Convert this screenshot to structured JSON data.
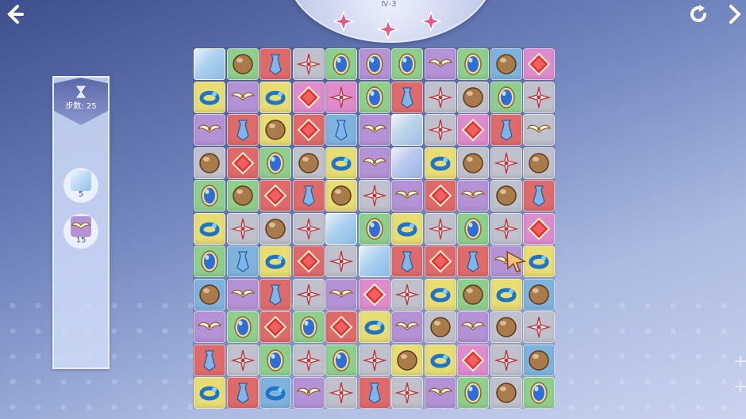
{
  "level": "Ⅳ-3",
  "stars": 3,
  "moves_label": "步数: 25",
  "goals": [
    {
      "icon": "ice-block-icon",
      "count": "5"
    },
    {
      "icon": "wing-bow-gem-icon",
      "count": "15"
    }
  ],
  "colors": {
    "yellow": "#e7dd73",
    "purple": "#b492d6",
    "red": "#df6a6a",
    "gray": "#bfc2cc",
    "green": "#8fcf8d",
    "blue": "#7fb3dd",
    "pink": "#de8ccc"
  },
  "board": [
    [
      [
        "blue",
        "ice"
      ],
      [
        "green",
        "ball"
      ],
      [
        "red",
        "tie"
      ],
      [
        "gray",
        "flower"
      ],
      [
        "green",
        "oval"
      ],
      [
        "purple",
        "oval"
      ],
      [
        "green",
        "oval"
      ],
      [
        "purple",
        "bow"
      ],
      [
        "green",
        "oval"
      ],
      [
        "blue",
        "ball"
      ],
      [
        "pink",
        "diamond"
      ]
    ],
    [
      [
        "yellow",
        "ring"
      ],
      [
        "purple",
        "bow"
      ],
      [
        "yellow",
        "ring"
      ],
      [
        "pink",
        "diamond"
      ],
      [
        "pink",
        "flower"
      ],
      [
        "green",
        "oval"
      ],
      [
        "red",
        "tie"
      ],
      [
        "gray",
        "flower"
      ],
      [
        "gray",
        "ball"
      ],
      [
        "green",
        "oval"
      ],
      [
        "gray",
        "flower"
      ]
    ],
    [
      [
        "purple",
        "bow"
      ],
      [
        "red",
        "tie"
      ],
      [
        "yellow",
        "ball"
      ],
      [
        "red",
        "diamond"
      ],
      [
        "blue",
        "tie"
      ],
      [
        "purple",
        "bow"
      ],
      [
        "gray",
        "ice"
      ],
      [
        "gray",
        "flower"
      ],
      [
        "pink",
        "diamond"
      ],
      [
        "red",
        "tie"
      ],
      [
        "gray",
        "bow"
      ]
    ],
    [
      [
        "gray",
        "ball"
      ],
      [
        "red",
        "diamond"
      ],
      [
        "green",
        "oval"
      ],
      [
        "gray",
        "ball"
      ],
      [
        "yellow",
        "ring"
      ],
      [
        "purple",
        "bow"
      ],
      [
        "purple",
        "ice"
      ],
      [
        "yellow",
        "ring"
      ],
      [
        "gray",
        "ball"
      ],
      [
        "gray",
        "flower"
      ],
      [
        "gray",
        "ball"
      ]
    ],
    [
      [
        "green",
        "oval"
      ],
      [
        "green",
        "ball"
      ],
      [
        "red",
        "diamond"
      ],
      [
        "red",
        "tie"
      ],
      [
        "yellow",
        "ball"
      ],
      [
        "gray",
        "flower"
      ],
      [
        "purple",
        "bow"
      ],
      [
        "red",
        "diamond"
      ],
      [
        "purple",
        "bow"
      ],
      [
        "gray",
        "ball"
      ],
      [
        "red",
        "tie"
      ]
    ],
    [
      [
        "yellow",
        "ring"
      ],
      [
        "gray",
        "flower"
      ],
      [
        "gray",
        "ball"
      ],
      [
        "gray",
        "flower"
      ],
      [
        "blue",
        "ice"
      ],
      [
        "green",
        "oval"
      ],
      [
        "yellow",
        "ring"
      ],
      [
        "gray",
        "flower"
      ],
      [
        "green",
        "oval"
      ],
      [
        "gray",
        "flower"
      ],
      [
        "pink",
        "diamond"
      ]
    ],
    [
      [
        "green",
        "oval"
      ],
      [
        "blue",
        "tie"
      ],
      [
        "yellow",
        "ring"
      ],
      [
        "red",
        "diamond"
      ],
      [
        "gray",
        "flower"
      ],
      [
        "blue",
        "ice"
      ],
      [
        "red",
        "tie"
      ],
      [
        "red",
        "diamond"
      ],
      [
        "red",
        "tie"
      ],
      [
        "purple",
        "bow"
      ],
      [
        "yellow",
        "ring"
      ]
    ],
    [
      [
        "blue",
        "ball"
      ],
      [
        "purple",
        "bow"
      ],
      [
        "red",
        "tie"
      ],
      [
        "gray",
        "flower"
      ],
      [
        "purple",
        "bow"
      ],
      [
        "pink",
        "diamond"
      ],
      [
        "gray",
        "flower"
      ],
      [
        "yellow",
        "ring"
      ],
      [
        "green",
        "ball"
      ],
      [
        "yellow",
        "ring"
      ],
      [
        "blue",
        "ball"
      ]
    ],
    [
      [
        "purple",
        "bow"
      ],
      [
        "green",
        "oval"
      ],
      [
        "red",
        "diamond"
      ],
      [
        "green",
        "oval"
      ],
      [
        "red",
        "diamond"
      ],
      [
        "yellow",
        "ring"
      ],
      [
        "purple",
        "bow"
      ],
      [
        "gray",
        "ball"
      ],
      [
        "purple",
        "bow"
      ],
      [
        "gray",
        "ball"
      ],
      [
        "gray",
        "flower"
      ]
    ],
    [
      [
        "red",
        "tie"
      ],
      [
        "gray",
        "flower"
      ],
      [
        "green",
        "oval"
      ],
      [
        "gray",
        "flower"
      ],
      [
        "green",
        "oval"
      ],
      [
        "gray",
        "flower"
      ],
      [
        "yellow",
        "ball"
      ],
      [
        "yellow",
        "ring"
      ],
      [
        "pink",
        "diamond"
      ],
      [
        "gray",
        "flower"
      ],
      [
        "blue",
        "ball"
      ]
    ],
    [
      [
        "yellow",
        "ring"
      ],
      [
        "red",
        "tie"
      ],
      [
        "blue",
        "ring"
      ],
      [
        "purple",
        "bow"
      ],
      [
        "gray",
        "flower"
      ],
      [
        "red",
        "tie"
      ],
      [
        "gray",
        "flower"
      ],
      [
        "purple",
        "bow"
      ],
      [
        "green",
        "oval"
      ],
      [
        "gray",
        "ball"
      ],
      [
        "green",
        "oval"
      ]
    ]
  ]
}
